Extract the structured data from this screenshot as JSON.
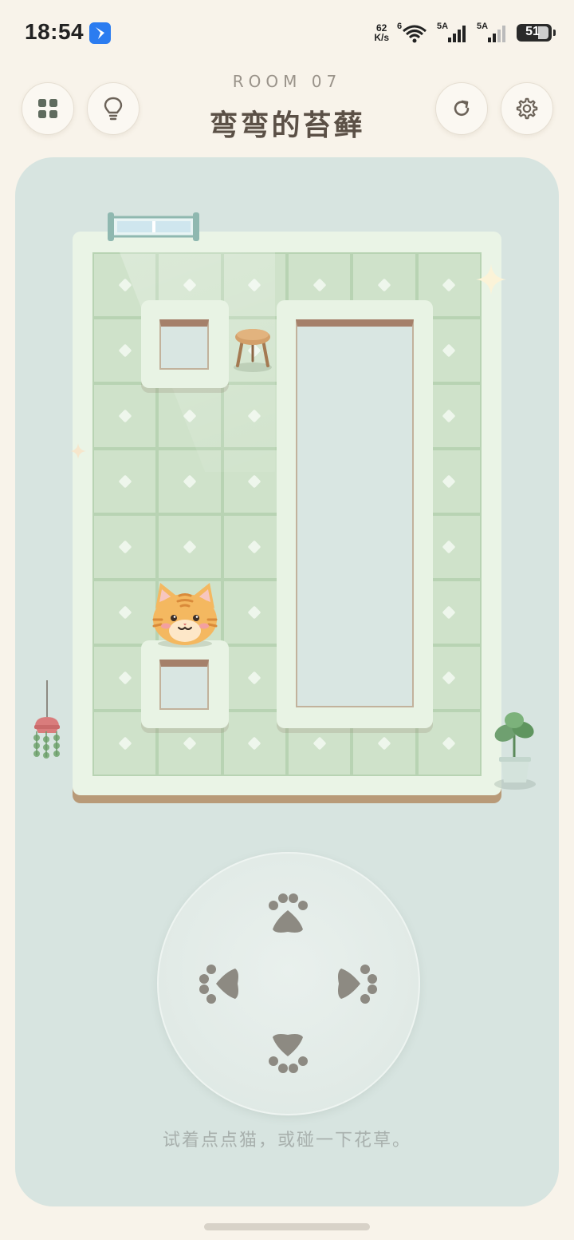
{
  "status_bar": {
    "time": "18:54",
    "net_speed_value": "62",
    "net_speed_unit": "K/s",
    "wifi_label": "6",
    "sim1_label": "5A",
    "sim2_label": "5A",
    "battery": "51",
    "battery_level": 0.51
  },
  "header": {
    "room_label": "ROOM 07",
    "title": "弯弯的苔藓",
    "menu_icon": "grid-icon",
    "hint_icon": "lightbulb-icon",
    "restart_icon": "restart-icon",
    "settings_icon": "gear-icon"
  },
  "board": {
    "columns": 6,
    "rows": 8,
    "cat_position": {
      "col": 1,
      "row": 5
    },
    "objects": [
      "window",
      "stool",
      "cat",
      "hanging-plant",
      "potted-plant"
    ]
  },
  "controls": {
    "up": "paw-up-icon",
    "left": "paw-left-icon",
    "right": "paw-right-icon",
    "down": "paw-down-icon"
  },
  "hint_text": "试着点点猫，或碰一下花草。",
  "colors": {
    "page_bg": "#f8f3ea",
    "card_bg": "#d7e4e0",
    "floor": "#cfe2ca",
    "wall": "#eaf4e6",
    "cat": "#f4b860",
    "paw": "#8d8a82"
  }
}
